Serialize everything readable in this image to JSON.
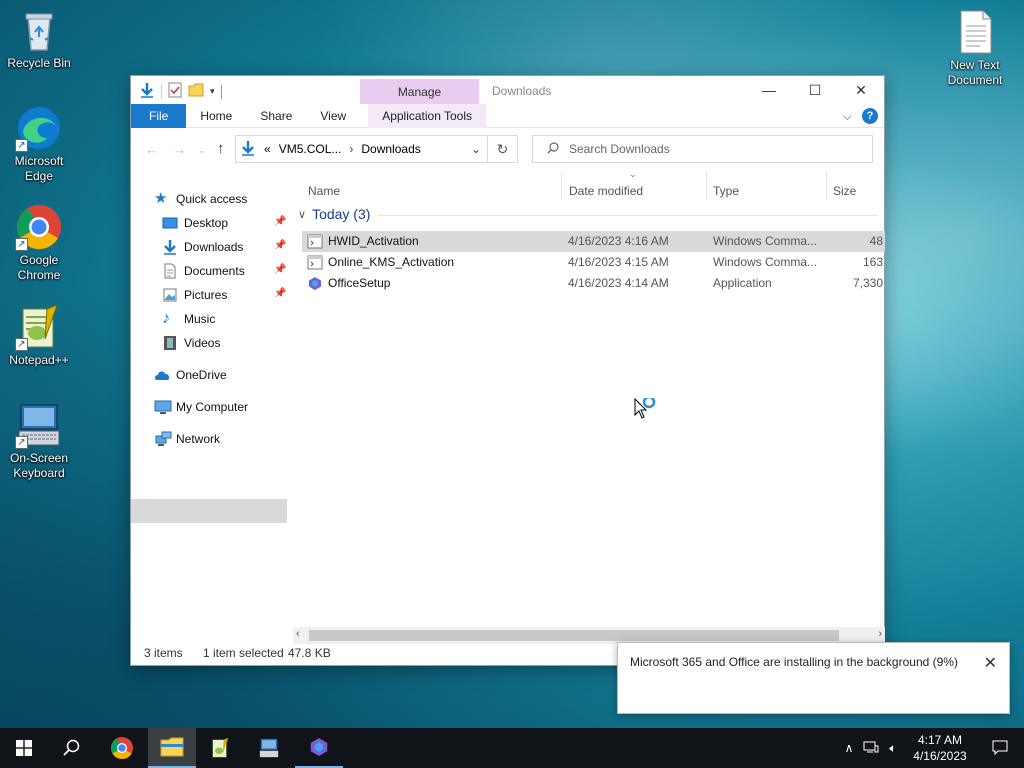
{
  "desktop": {
    "icons": [
      {
        "label": "Recycle Bin"
      },
      {
        "label": "Microsoft Edge"
      },
      {
        "label": "Google Chrome"
      },
      {
        "label": "Notepad++"
      },
      {
        "label": "On-Screen Keyboard"
      },
      {
        "label": "New Text Document"
      }
    ]
  },
  "window": {
    "title": "Downloads",
    "context_tab": "Manage",
    "ribbon_tabs": [
      "File",
      "Home",
      "Share",
      "View",
      "Application Tools"
    ],
    "address": {
      "prefix": "«",
      "segment1": "VM5.COL...",
      "segment2": "Downloads"
    },
    "search_placeholder": "Search Downloads",
    "nav": {
      "quick_access": "Quick access",
      "items": [
        {
          "label": "Desktop",
          "pinned": true
        },
        {
          "label": "Downloads",
          "pinned": true
        },
        {
          "label": "Documents",
          "pinned": true
        },
        {
          "label": "Pictures",
          "pinned": true
        },
        {
          "label": "Music",
          "pinned": false
        },
        {
          "label": "Videos",
          "pinned": false
        }
      ],
      "onedrive": "OneDrive",
      "my_computer": "My Computer",
      "network": "Network"
    },
    "columns": [
      "Name",
      "Date modified",
      "Type",
      "Size"
    ],
    "group": "Today (3)",
    "files": [
      {
        "name": "HWID_Activation",
        "date": "4/16/2023 4:16 AM",
        "type": "Windows Comma...",
        "size": "48",
        "selected": true
      },
      {
        "name": "Online_KMS_Activation",
        "date": "4/16/2023 4:15 AM",
        "type": "Windows Comma...",
        "size": "163",
        "selected": false
      },
      {
        "name": "OfficeSetup",
        "date": "4/16/2023 4:14 AM",
        "type": "Application",
        "size": "7,330",
        "selected": false
      }
    ],
    "status": {
      "items": "3 items",
      "selected": "1 item selected",
      "size": "47.8 KB"
    }
  },
  "toast": {
    "message": "Microsoft 365 and Office are installing in the background (9%)"
  },
  "taskbar": {
    "time": "4:17 AM",
    "date": "4/16/2023"
  },
  "colors": {
    "accent": "#1979ca",
    "manage_tab": "#e8cdf0",
    "selection": "#d9d9d9",
    "taskbar": "#101418"
  }
}
